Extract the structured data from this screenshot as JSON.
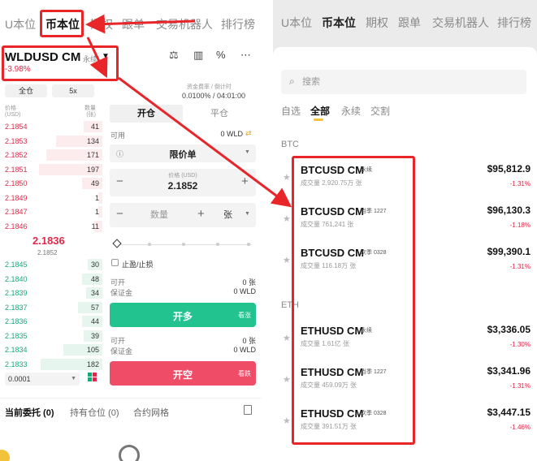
{
  "left": {
    "nav": [
      "U本位",
      "币本位",
      "期权",
      "跟单",
      "交易机器人",
      "排行榜"
    ],
    "pair": {
      "name": "WLDUSD CM",
      "type": "永续",
      "change": "-3.98%"
    },
    "modes": {
      "margin": "全仓",
      "leverage": "5x"
    },
    "fee": {
      "label": "资金费率 / 倒计时",
      "value": "0.0100% / 04:01:00"
    },
    "orderbook": {
      "price_head": "价格\n(USD)",
      "qty_head": "数量\n(张)",
      "asks": [
        {
          "price": "2.1854",
          "qty": "41",
          "depth": 0.18
        },
        {
          "price": "2.1853",
          "qty": "134",
          "depth": 0.45
        },
        {
          "price": "2.1852",
          "qty": "171",
          "depth": 0.55
        },
        {
          "price": "2.1851",
          "qty": "197",
          "depth": 0.62
        },
        {
          "price": "2.1850",
          "qty": "49",
          "depth": 0.2
        },
        {
          "price": "2.1849",
          "qty": "1",
          "depth": 0.04
        },
        {
          "price": "2.1847",
          "qty": "1",
          "depth": 0.04
        },
        {
          "price": "2.1846",
          "qty": "11",
          "depth": 0.08
        }
      ],
      "mid": "2.1836",
      "mid_sub": "2.1852",
      "bids": [
        {
          "price": "2.1845",
          "qty": "30",
          "depth": 0.14
        },
        {
          "price": "2.1840",
          "qty": "48",
          "depth": 0.2
        },
        {
          "price": "2.1839",
          "qty": "34",
          "depth": 0.16
        },
        {
          "price": "2.1837",
          "qty": "57",
          "depth": 0.24
        },
        {
          "price": "2.1836",
          "qty": "44",
          "depth": 0.2
        },
        {
          "price": "2.1835",
          "qty": "39",
          "depth": 0.18
        },
        {
          "price": "2.1834",
          "qty": "105",
          "depth": 0.38
        },
        {
          "price": "2.1833",
          "qty": "182",
          "depth": 0.6
        }
      ],
      "step": "0.0001"
    },
    "form": {
      "tab_open": "开仓",
      "tab_close": "平仓",
      "avail_label": "可用",
      "avail_value": "0 WLD",
      "order_type": "限价单",
      "price_label": "价格 (USD)",
      "price_value": "2.1852",
      "qty_placeholder": "数量",
      "unit": "张",
      "tpsl": "止盈/止损",
      "open_label": "可开",
      "open_value": "0 张",
      "margin_label": "保证金",
      "margin_value": "0 WLD",
      "long_label": "开多",
      "long_sub": "看涨",
      "open_label2": "可开",
      "open_value2": "0 张",
      "margin_label2": "保证金",
      "margin_value2": "0 WLD",
      "short_label": "开空",
      "short_sub": "看跌"
    },
    "bottom_tabs": [
      "当前委托 (0)",
      "持有仓位 (0)",
      "合约网格"
    ]
  },
  "right": {
    "nav": [
      "U本位",
      "币本位",
      "期权",
      "跟单",
      "交易机器人",
      "排行榜"
    ],
    "search_placeholder": "搜索",
    "tabs": [
      "自选",
      "全部",
      "永续",
      "交割"
    ],
    "groups": [
      {
        "title": "BTC",
        "items": [
          {
            "name": "BTCUSD CM",
            "tag": "永续",
            "vol": "成交量 2,920.75万 张",
            "price": "$95,812.9",
            "change": "-1.31%"
          },
          {
            "name": "BTCUSD CM",
            "tag": "当季 1227",
            "vol": "成交量 761,241 张",
            "price": "$96,130.3",
            "change": "-1.18%"
          },
          {
            "name": "BTCUSD CM",
            "tag": "次季 0328",
            "vol": "成交量 116.18万 张",
            "price": "$99,390.1",
            "change": "-1.31%"
          }
        ]
      },
      {
        "title": "ETH",
        "items": [
          {
            "name": "ETHUSD CM",
            "tag": "永续",
            "vol": "成交量 1.61亿 张",
            "price": "$3,336.05",
            "change": "-1.30%"
          },
          {
            "name": "ETHUSD CM",
            "tag": "当季 1227",
            "vol": "成交量 459.09万 张",
            "price": "$3,341.96",
            "change": "-1.31%"
          },
          {
            "name": "ETHUSD CM",
            "tag": "次季 0328",
            "vol": "成交量 391.51万 张",
            "price": "$3,447.15",
            "change": "-1.46%"
          }
        ]
      }
    ]
  },
  "colors": {
    "accent": "#f2c33a",
    "up": "#22c38e",
    "down": "#ef4c68",
    "annotation": "#e8262a"
  },
  "icons": [
    "candle-tool-icon",
    "chart-icon",
    "percent-icon",
    "more-icon",
    "search-icon",
    "star-icon",
    "document-icon",
    "layout-icon"
  ]
}
